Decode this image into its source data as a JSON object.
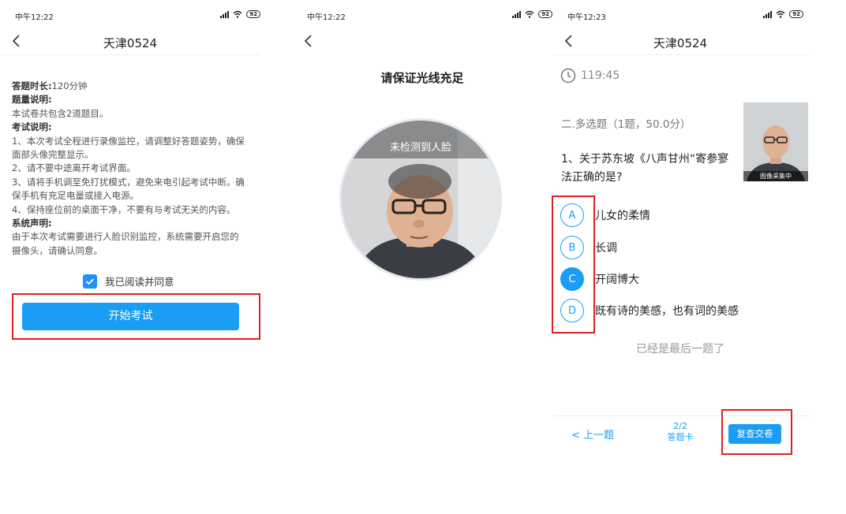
{
  "screen1": {
    "time": "中午12:22",
    "battery": "92",
    "title": "天津0524",
    "duration_label": "答题时长:",
    "duration_value": "120分钟",
    "count_label": "题量说明:",
    "count_text": "本试卷共包含2道题目。",
    "rules_label": "考试说明:",
    "rule1_a": "1、本次考试全程进行录像监控，请调整好答题姿势，确保",
    "rule1_b": "面部头像完整显示。",
    "rule2": "2、请不要中途离开考试界面。",
    "rule3_a": "3、请将手机调至免打扰模式，避免来电引起考试中断。确",
    "rule3_b": "保手机有充足电量或接入电源。",
    "rule4": "4、保持座位前的桌面干净，不要有与考试无关的内容。",
    "system_label": "系统声明:",
    "system_a": "由于本次考试需要进行人脸识别监控，系统需要开启您的",
    "system_b": "摄像头，请确认同意。",
    "agree_text": "我已阅读并同意",
    "start_button": "开始考试"
  },
  "screen2": {
    "time": "中午12:22",
    "battery": "92",
    "tip": "请保证光线充足",
    "face_status": "未检测到人脸"
  },
  "screen3": {
    "time": "中午12:23",
    "battery": "92",
    "title": "天津0524",
    "timer": "119:45",
    "question_type": "二.多选题（1题，50.0分）",
    "question_line1": "1、关于苏东坡《八声甘州“寄参寥",
    "question_line2": "法正确的是?",
    "camera_label": "图像采集中",
    "options": [
      {
        "letter": "A",
        "text": "儿女的柔情",
        "selected": false
      },
      {
        "letter": "B",
        "text": "长调",
        "selected": false
      },
      {
        "letter": "C",
        "text": "开阔博大",
        "selected": true
      },
      {
        "letter": "D",
        "text": "既有诗的美感，也有词的美感",
        "selected": false
      }
    ],
    "last_tip": "已经是最后一题了",
    "prev_button": "< 上一题",
    "card_progress": "2/2",
    "card_label": "答题卡",
    "submit_button": "复查交卷"
  },
  "colors": {
    "accent": "#1a9df5",
    "highlight_box": "#e02020"
  }
}
